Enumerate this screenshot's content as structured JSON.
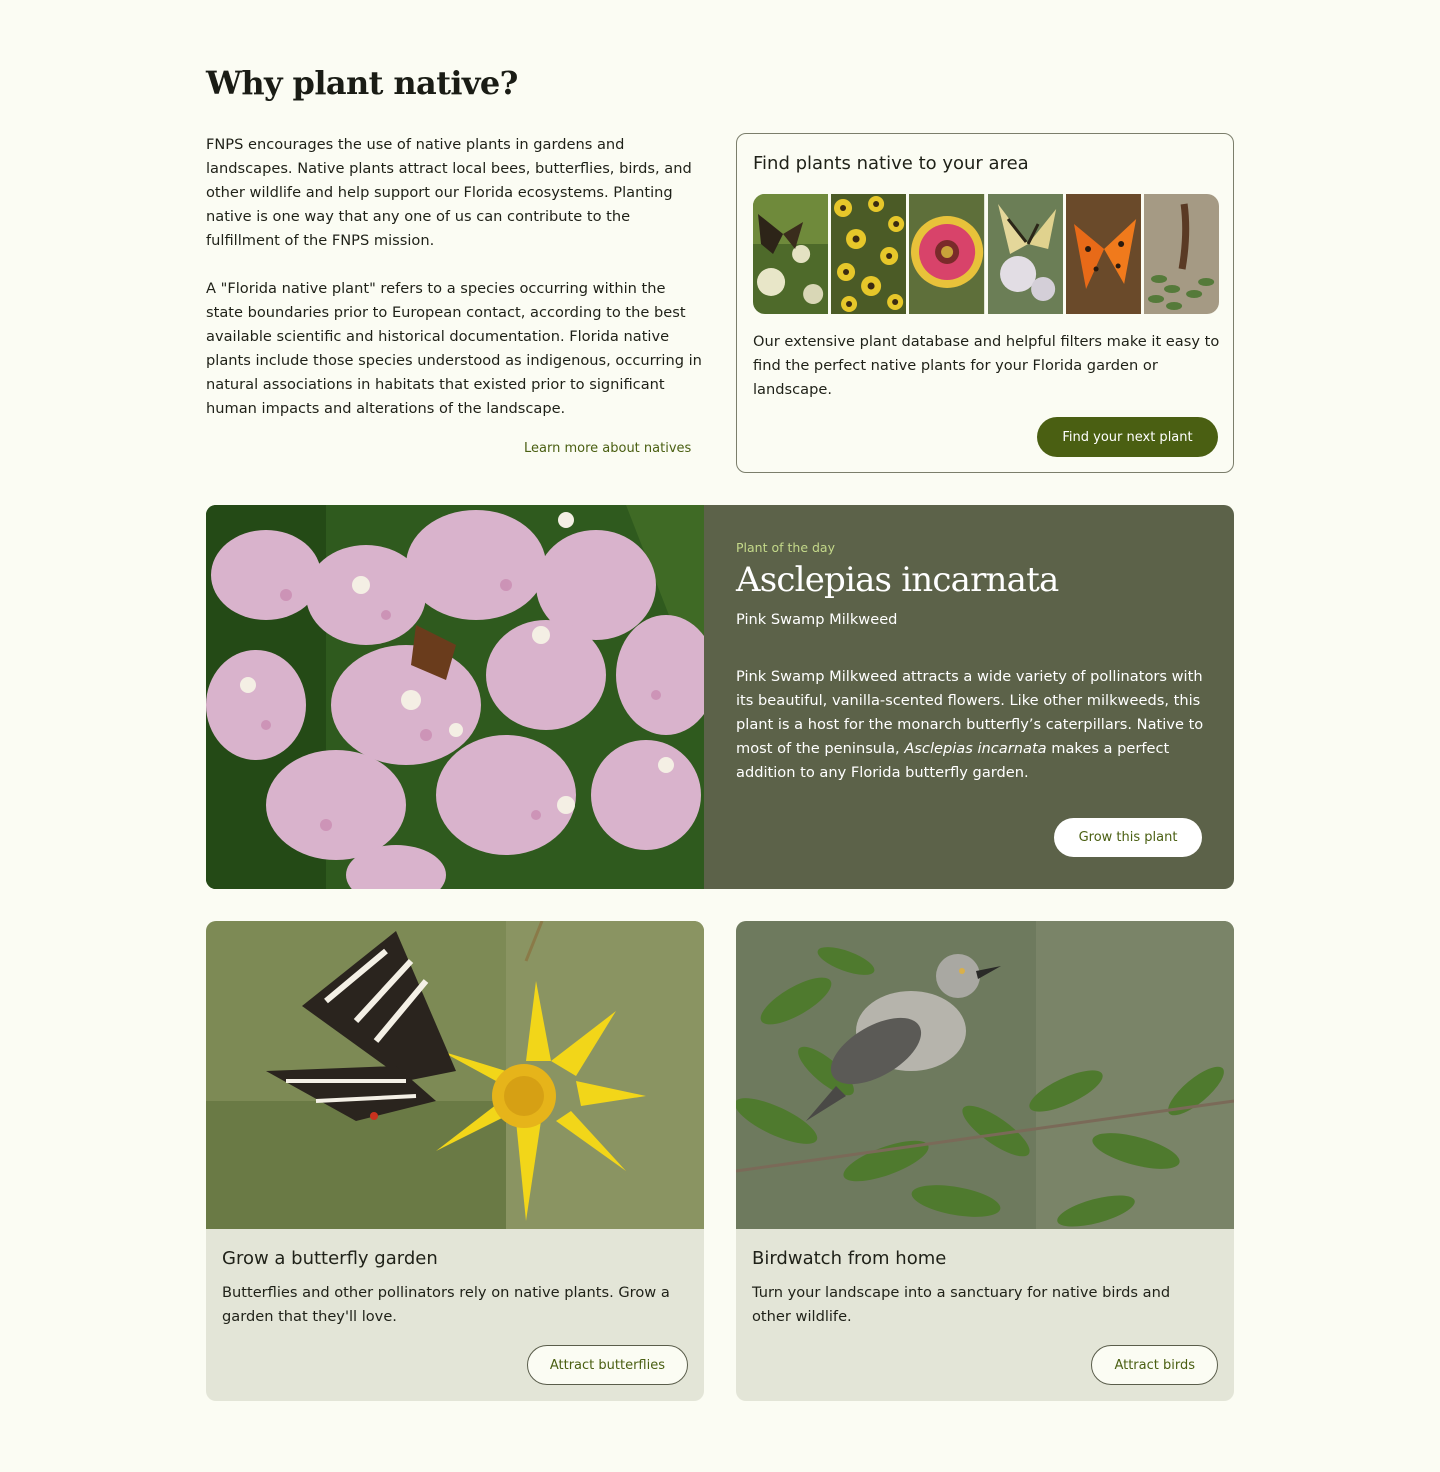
{
  "heading": "Why plant native?",
  "intro": {
    "p1": "FNPS encourages the use of native plants in gardens and landscapes. Native plants attract local bees, butterflies, birds, and other wildlife and help support our Florida ecosystems. Planting native is one way that any one of us can contribute to the fulfillment of the FNPS mission.",
    "p2": "A \"Florida native plant\" refers to a species occurring within the state boundaries prior to European contact, according to the best available scientific and historical documentation. Florida native plants include those species understood as indigenous, occurring in natural associations in habitats that existed prior to significant human impacts and alterations of the landscape.",
    "link": "Learn more about natives"
  },
  "finder": {
    "title": "Find plants native to your area",
    "text": "Our extensive plant database and helpful filters make it easy to find the perfect native plants for your Florida garden or landscape.",
    "button": "Find your next plant"
  },
  "plant_of_day": {
    "kicker": "Plant of the day",
    "scientific_name": "Asclepias incarnata",
    "common_name": "Pink Swamp Milkweed",
    "desc_before": "Pink Swamp Milkweed attracts a wide variety of pollinators with its beautiful, vanilla-scented flowers. Like other milkweeds, this plant is a host for the monarch butterfly’s caterpillars. Native to most of the peninsula, ",
    "desc_italic": "Asclepias incarnata",
    "desc_after": " makes a perfect addition to any Florida butterfly garden.",
    "button": "Grow this plant"
  },
  "cards": {
    "butterfly": {
      "title": "Grow a butterfly garden",
      "text": "Butterflies and other pollinators rely on native plants. Grow a garden that they'll love.",
      "button": "Attract butterflies"
    },
    "birds": {
      "title": "Birdwatch from home",
      "text": "Turn your landscape into a sanctuary for native birds and other wildlife.",
      "button": "Attract birds"
    }
  },
  "colors": {
    "page_bg": "#fbfcf3",
    "accent": "#4a5f12",
    "potd_bg": "#5c6249",
    "card_bg": "#e3e5d7",
    "kicker": "#c4d98a"
  }
}
